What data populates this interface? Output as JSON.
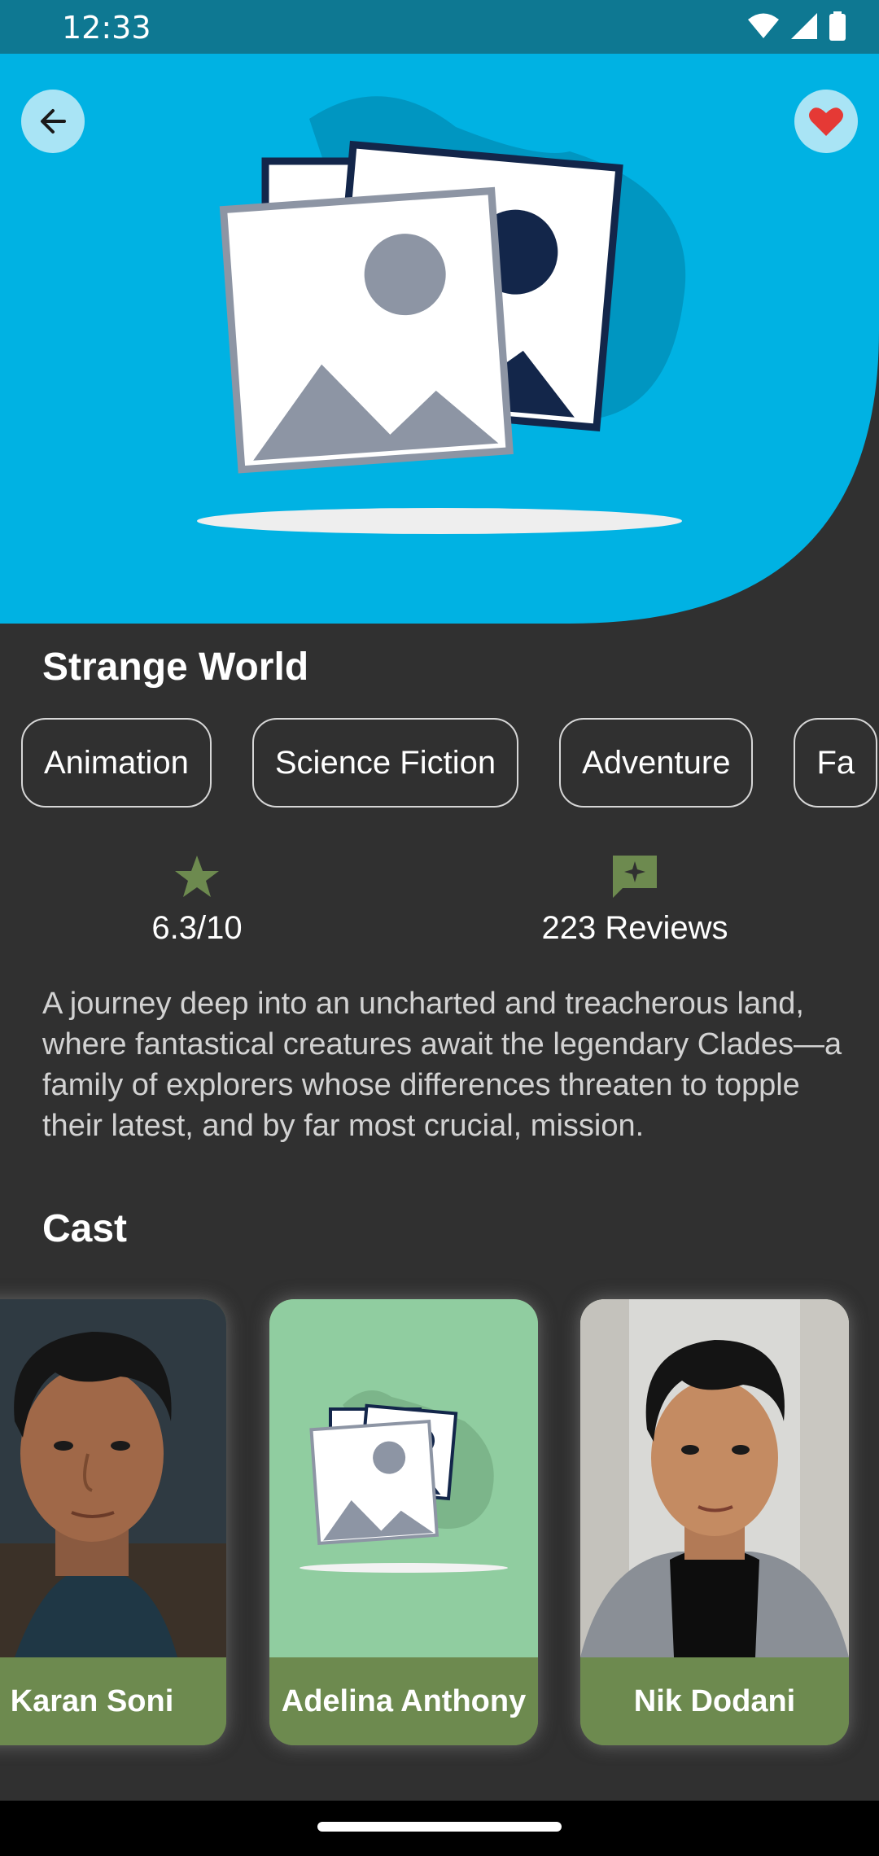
{
  "status_bar": {
    "time": "12:33"
  },
  "movie": {
    "title": "Strange World",
    "genres": [
      "Animation",
      "Science Fiction",
      "Adventure",
      "Fa"
    ],
    "rating": "6.3/10",
    "reviews": "223 Reviews",
    "description": "A journey deep into an uncharted and treacherous land, where fantastical creatures await the legendary Clades—a family of explorers whose differences threaten to topple their latest, and by far most crucial, mission."
  },
  "cast": {
    "heading": "Cast",
    "members": [
      {
        "name": "Karan Soni"
      },
      {
        "name": "Adelina Anthony"
      },
      {
        "name": "Nik Dodani"
      }
    ]
  },
  "colors": {
    "hero_background": "#00b2e3",
    "page_background": "#303030",
    "accent_green": "#6d8a4f",
    "placeholder_green": "#90cda0",
    "favorite_red": "#e53935"
  },
  "icons": {
    "back": "arrow-left-icon",
    "favorite": "heart-icon",
    "rating": "star-icon",
    "reviews": "review-chat-icon"
  }
}
